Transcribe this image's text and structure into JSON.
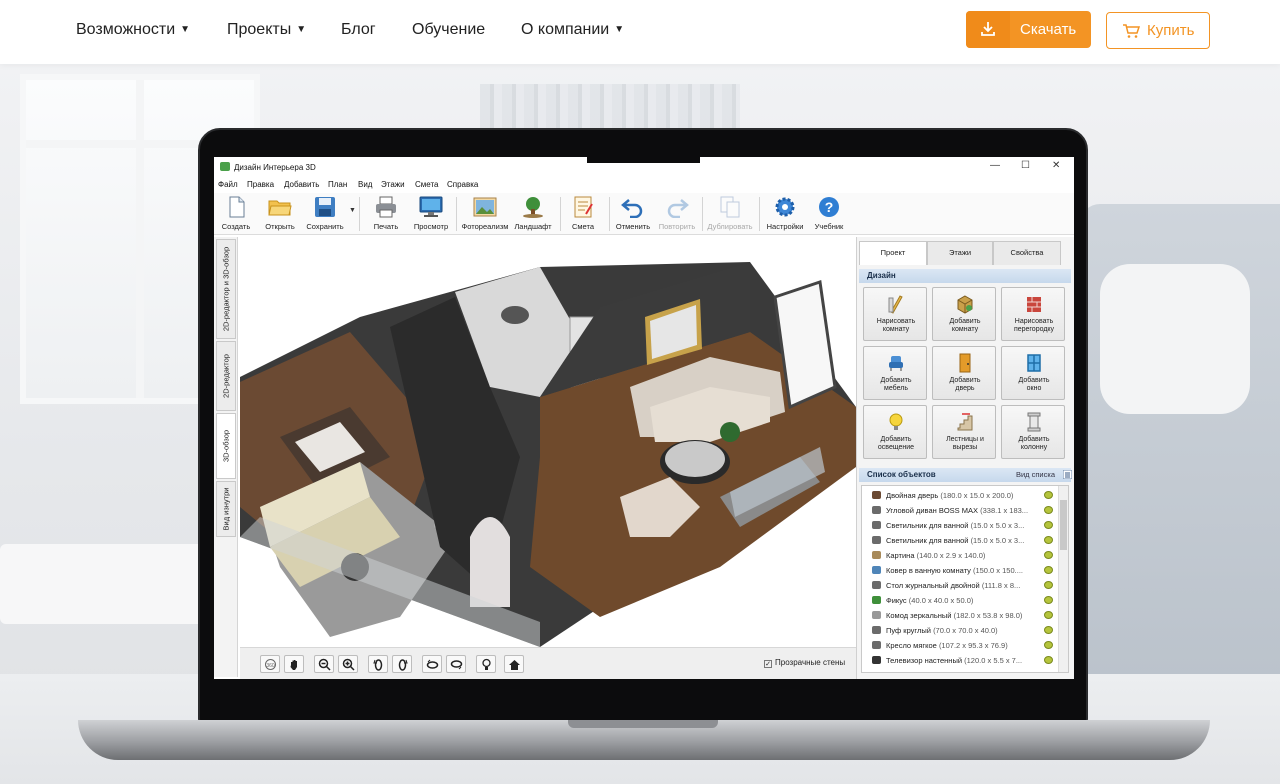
{
  "site_nav": {
    "items": [
      {
        "label": "Возможности",
        "has_caret": true
      },
      {
        "label": "Проекты",
        "has_caret": true
      },
      {
        "label": "Блог",
        "has_caret": false
      },
      {
        "label": "Обучение",
        "has_caret": false
      },
      {
        "label": "О компании",
        "has_caret": true
      }
    ],
    "download_label": "Скачать",
    "buy_label": "Купить",
    "accent_color": "#f39424"
  },
  "app": {
    "title": "Дизайн Интерьера 3D",
    "menu": [
      "Файл",
      "Правка",
      "Добавить",
      "План",
      "Вид",
      "Этажи",
      "Смета",
      "Справка"
    ],
    "toolbar": [
      {
        "label": "Создать",
        "icon": "new-file-icon"
      },
      {
        "label": "Открыть",
        "icon": "folder-open-icon"
      },
      {
        "label": "Сохранить",
        "icon": "save-icon"
      },
      {
        "label": "Печать",
        "icon": "printer-icon"
      },
      {
        "label": "Просмотр",
        "icon": "monitor-icon"
      },
      {
        "label": "Фотореализм",
        "icon": "photo-icon"
      },
      {
        "label": "Ландшафт",
        "icon": "tree-icon"
      },
      {
        "label": "Смета",
        "icon": "estimate-icon"
      },
      {
        "label": "Отменить",
        "icon": "undo-icon"
      },
      {
        "label": "Повторить",
        "icon": "redo-icon",
        "disabled": true
      },
      {
        "label": "Дублировать",
        "icon": "duplicate-icon",
        "disabled": true
      },
      {
        "label": "Настройки",
        "icon": "gear-icon"
      },
      {
        "label": "Учебник",
        "icon": "help-icon"
      }
    ],
    "side_tabs": [
      "2D-редактор и 3D-обзор",
      "2D-редактор",
      "3D-обзор",
      "Вид изнутри"
    ],
    "active_side_tab": "3D-обзор",
    "transparent_walls_label": "Прозрачные стены",
    "transparent_walls_checked": true,
    "panel": {
      "tabs": [
        "Проект",
        "Этажи",
        "Свойства"
      ],
      "active_tab": "Проект",
      "design_title": "Дизайн",
      "design_buttons": [
        [
          "Нарисовать",
          "комнату"
        ],
        [
          "Добавить",
          "комнату"
        ],
        [
          "Нарисовать",
          "перегородку"
        ],
        [
          "Добавить",
          "мебель"
        ],
        [
          "Добавить",
          "дверь"
        ],
        [
          "Добавить",
          "окно"
        ],
        [
          "Добавить",
          "освещение"
        ],
        [
          "Лестницы и",
          "вырезы"
        ],
        [
          "Добавить",
          "колонну"
        ]
      ],
      "objects_title": "Список объектов",
      "objects_view_label": "Вид списка",
      "objects": [
        {
          "name": "Двойная дверь",
          "dims": "(180.0 x 15.0 x 200.0)"
        },
        {
          "name": "Угловой диван BOSS MAX",
          "dims": "(338.1 x 183..."
        },
        {
          "name": "Светильник для ванной",
          "dims": "(15.0 x 5.0 x 3..."
        },
        {
          "name": "Светильник для ванной",
          "dims": "(15.0 x 5.0 x 3..."
        },
        {
          "name": "Картина",
          "dims": "(140.0 x 2.9 x 140.0)"
        },
        {
          "name": "Ковер в ванную комнату",
          "dims": "(150.0 x 150...."
        },
        {
          "name": "Стол журнальный двойной",
          "dims": "(111.8 x 8..."
        },
        {
          "name": "Фикус",
          "dims": "(40.0 x 40.0 x 50.0)"
        },
        {
          "name": "Комод зеркальный",
          "dims": "(182.0 x 53.8 x 98.0)"
        },
        {
          "name": "Пуф круглый",
          "dims": "(70.0 x 70.0 x 40.0)"
        },
        {
          "name": "Кресло мягкое",
          "dims": "(107.2 x 95.3 x 76.9)"
        },
        {
          "name": "Телевизор настенный",
          "dims": "(120.0 x 5.5 x 7..."
        }
      ]
    }
  }
}
